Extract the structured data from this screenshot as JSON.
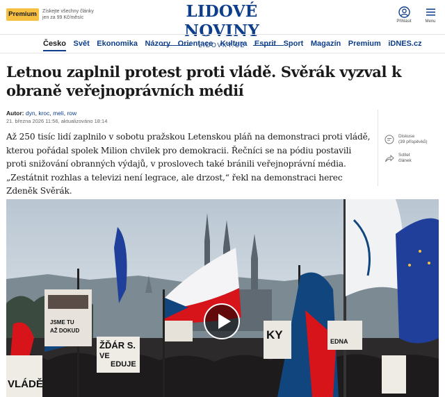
{
  "topbar": {
    "premium_label": "Premium",
    "promo_text": "Získejte všechny články jen za 99 Kč/měsíc",
    "logo_main": "LIDOVÉ NOVINY",
    "logo_sub": "LIDOVKY.CZ",
    "login_label": "Přihlásit",
    "menu_label": "Menu",
    "login_icon": "user-icon",
    "menu_icon": "hamburger-icon"
  },
  "nav": {
    "items": [
      "Česko",
      "Svět",
      "Ekonomika",
      "Názory",
      "Orientace",
      "Kultura",
      "Esprit",
      "Sport",
      "Magazín",
      "Premium",
      "iDNES.cz"
    ],
    "active": "Česko"
  },
  "article": {
    "headline": "Letnou zaplnil protest proti vládě. Svěrák vyzval k obraně veřejnoprávních médií",
    "author_label": "Autor:",
    "authors": [
      "dyn",
      "kroc",
      "meli",
      "row"
    ],
    "date": "21. března 2026 11:56,",
    "updated": "aktualizováno  18:14",
    "perex": "Až 250 tisíc lidí zaplnilo v sobotu pražskou Letenskou pláň na demonstraci proti vládě, kterou pořádal spolek Milion chvilek pro demokracii. Řečníci se na pódiu postavili proti snižování obranných výdajů, v proslovech také bránili veřejnoprávní média. „Zestátnit rozhlas a televizi není legrace, ale drzost,“ řekl na demonstraci herec Zdeněk Svěrák."
  },
  "side": {
    "discuss_label": "Diskuse",
    "discuss_count": "(39 příspěvků)",
    "share_label": "Sdílet",
    "share_sub": "článek",
    "discuss_icon": "comment-icon",
    "share_icon": "share-icon"
  },
  "photo": {
    "play_icon": "play-icon",
    "signs": {
      "sign1_line1": "JSME TU",
      "sign1_line2": "AŽ DOKUD",
      "sign2": "ŽĎÁR S.",
      "sign2_b": "VE",
      "sign2_c": "EDUJE",
      "sign3": "VLÁDĚ",
      "sign4": "KY",
      "sign5": "EDNA"
    },
    "colors": {
      "sky": "#c9d4de",
      "flag_white": "#f4f4f6",
      "flag_red": "#d7141a",
      "flag_blue": "#11457e",
      "eu_blue": "#1f3f9b"
    }
  }
}
